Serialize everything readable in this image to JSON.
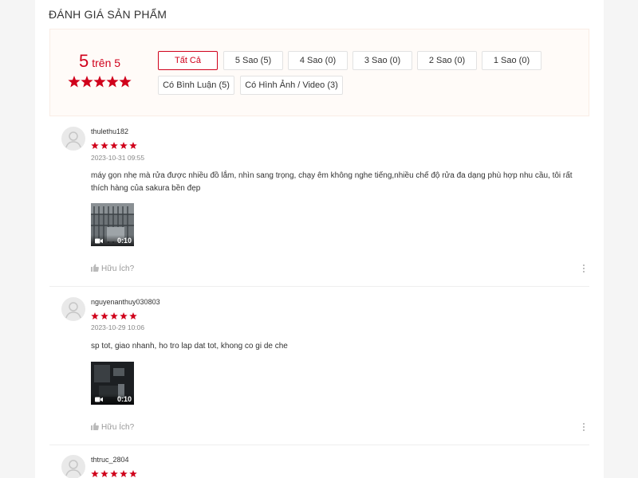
{
  "section_title": "ĐÁNH GIÁ SẢN PHẨM",
  "overview": {
    "score": "5",
    "score_suffix": "trên 5",
    "rating": 5,
    "accent_color": "#d0011b",
    "filters": [
      {
        "label": "Tất Cả",
        "active": true
      },
      {
        "label": "5 Sao (5)",
        "active": false
      },
      {
        "label": "4 Sao (0)",
        "active": false
      },
      {
        "label": "3 Sao (0)",
        "active": false
      },
      {
        "label": "2 Sao (0)",
        "active": false
      },
      {
        "label": "1 Sao (0)",
        "active": false
      },
      {
        "label": "Có Bình Luận (5)",
        "active": false
      },
      {
        "label": "Có Hình Ảnh / Video (3)",
        "active": false
      }
    ]
  },
  "reviews": [
    {
      "username": "thulethu182",
      "rating": 5,
      "time": "2023-10-31 09:55",
      "text": "máy gọn nhẹ mà rửa được nhiều đồ lắm, nhìn sang trọng, chạy êm không nghe tiếng,nhiều chế độ rửa đa dạng phù hợp nhu cầu, tôi rất thích hàng của sakura bền đẹp",
      "media": {
        "type": "video",
        "duration": "0:10"
      },
      "helpful_label": "Hữu Ích?"
    },
    {
      "username": "nguyenanthuy030803",
      "rating": 5,
      "time": "2023-10-29 10:06",
      "text": "sp tot, giao nhanh, ho tro lap dat tot, khong co gi de che",
      "media": {
        "type": "video",
        "duration": "0:10"
      },
      "helpful_label": "Hữu Ích?"
    },
    {
      "username": "thtruc_2804",
      "rating": 5
    }
  ]
}
